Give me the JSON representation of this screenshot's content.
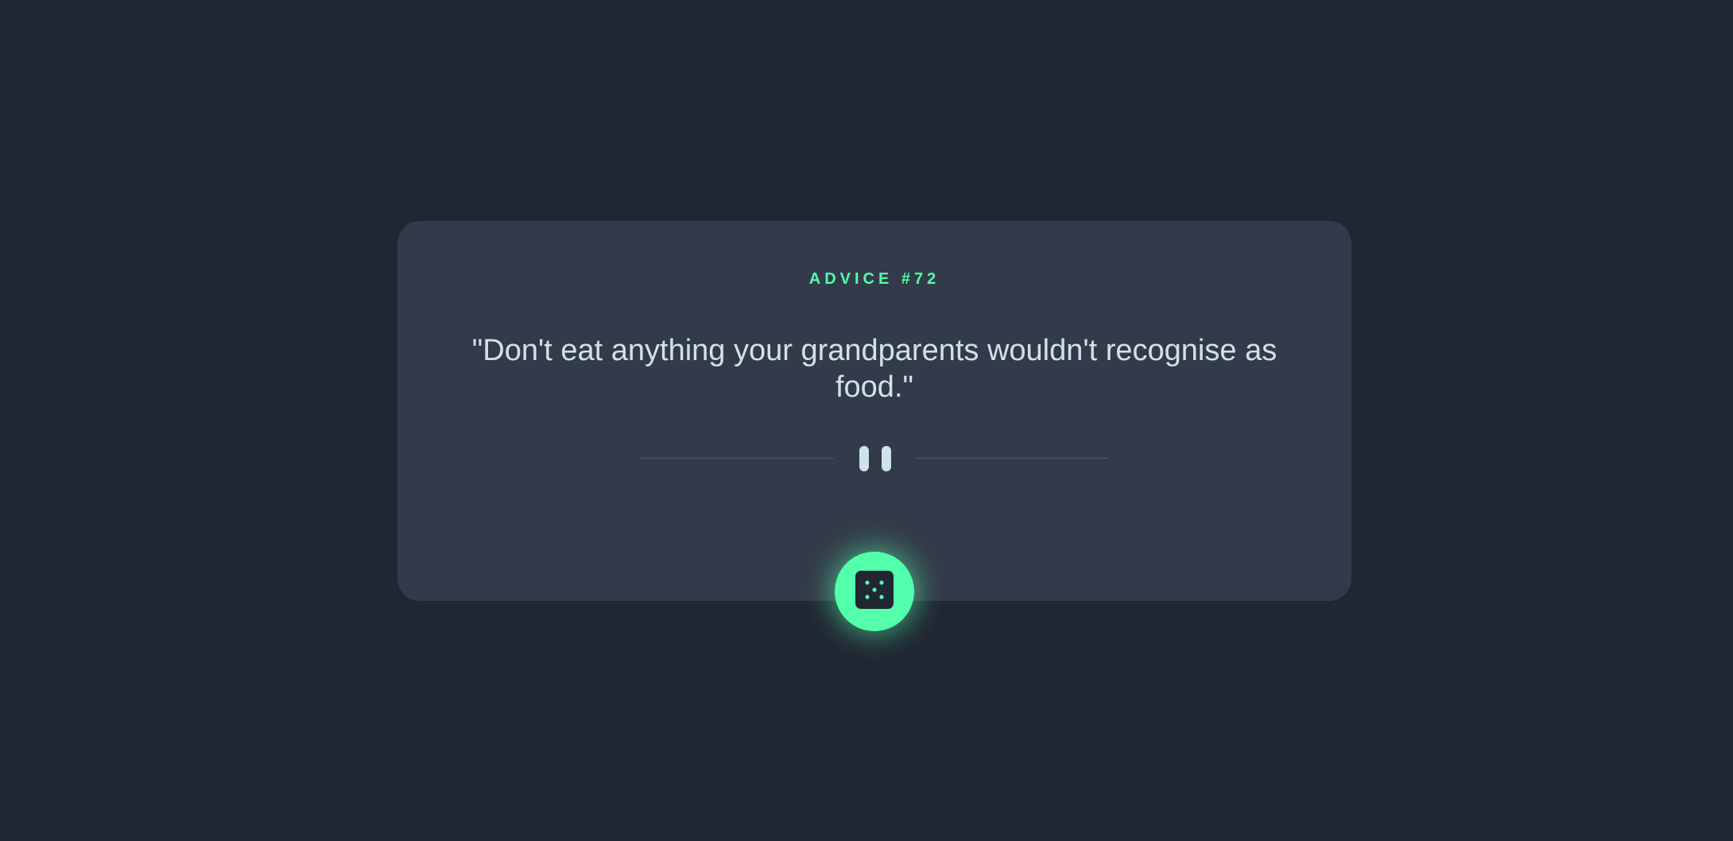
{
  "advice": {
    "label": "ADVICE #72",
    "quote": "\"Don't eat anything your grandparents wouldn't recognise as food.\""
  },
  "icons": {
    "divider": "pause-icon",
    "button": "dice-icon"
  },
  "colors": {
    "background": "#202632",
    "card": "#333A49",
    "accent": "#53FFAA",
    "text": "#CEE3E9",
    "divider": "#4F5D74"
  }
}
